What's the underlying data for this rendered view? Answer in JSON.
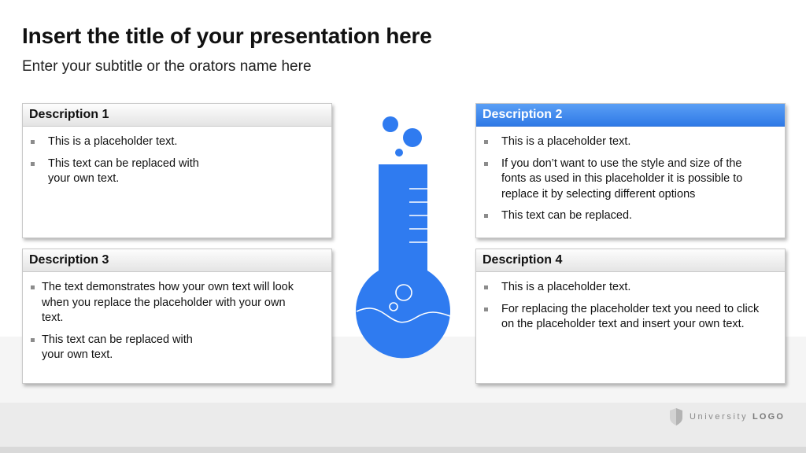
{
  "slide": {
    "title": "Insert the title of your presentation here",
    "subtitle": "Enter your subtitle or the orators name here"
  },
  "cards": [
    {
      "heading": "Description 1",
      "bullets": [
        "This is a placeholder text.",
        "This text can be replaced with\nyour own text."
      ]
    },
    {
      "heading": "Description 2",
      "bullets": [
        "This is a placeholder text.",
        "If you don’t want to use the style and size of the\nfonts as used in this placeholder it is possible to\nreplace it by selecting different options",
        "This text can be replaced."
      ]
    },
    {
      "heading": "Description 3",
      "bullets": [
        "The text demonstrates how your own text will look\nwhen you replace the placeholder with your own\ntext.",
        "This text can be replaced with\nyour own text."
      ]
    },
    {
      "heading": "Description 4",
      "bullets": [
        "This is a placeholder text.",
        "For replacing the placeholder text you need to click\non the placeholder text and insert your own text."
      ]
    }
  ],
  "footer": {
    "logo_word": "University",
    "logo_mark": "LOGO",
    "logo_icon": "shield-icon"
  },
  "colors": {
    "accent": "#2f7bf0",
    "accent_header": "#3d86ec"
  },
  "illustration": {
    "icon": "flask-icon"
  }
}
